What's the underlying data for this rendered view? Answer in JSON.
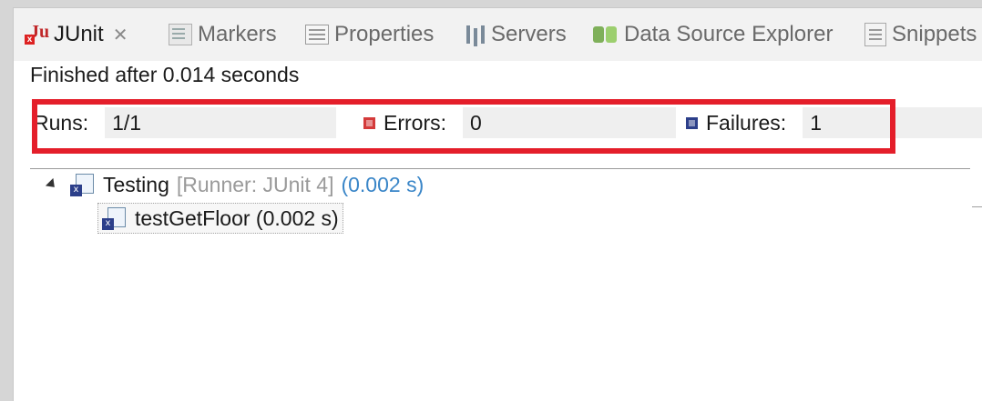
{
  "tabs": [
    {
      "label": "JUnit",
      "icon": "junit-icon",
      "active": true,
      "closable": true
    },
    {
      "label": "Markers",
      "icon": "markers-icon",
      "active": false
    },
    {
      "label": "Properties",
      "icon": "properties-icon",
      "active": false
    },
    {
      "label": "Servers",
      "icon": "servers-icon",
      "active": false
    },
    {
      "label": "Data Source Explorer",
      "icon": "data-source-explorer-icon",
      "active": false
    },
    {
      "label": "Snippets",
      "icon": "snippets-icon",
      "active": false
    }
  ],
  "status": "Finished after 0.014 seconds",
  "counters": {
    "runs_label": "Runs:",
    "runs_value": "1/1",
    "errors_label": "Errors:",
    "errors_value": "0",
    "failures_label": "Failures:",
    "failures_value": "1"
  },
  "tree": {
    "suite": {
      "name": "Testing",
      "runner": "[Runner: JUnit 4]",
      "time": "(0.002 s)"
    },
    "case": {
      "name": "testGetFloor (0.002 s)"
    }
  },
  "colors": {
    "highlight": "#e41e2a",
    "error": "#d43a3a",
    "failure": "#2c3f8a",
    "time": "#3a86c8"
  }
}
